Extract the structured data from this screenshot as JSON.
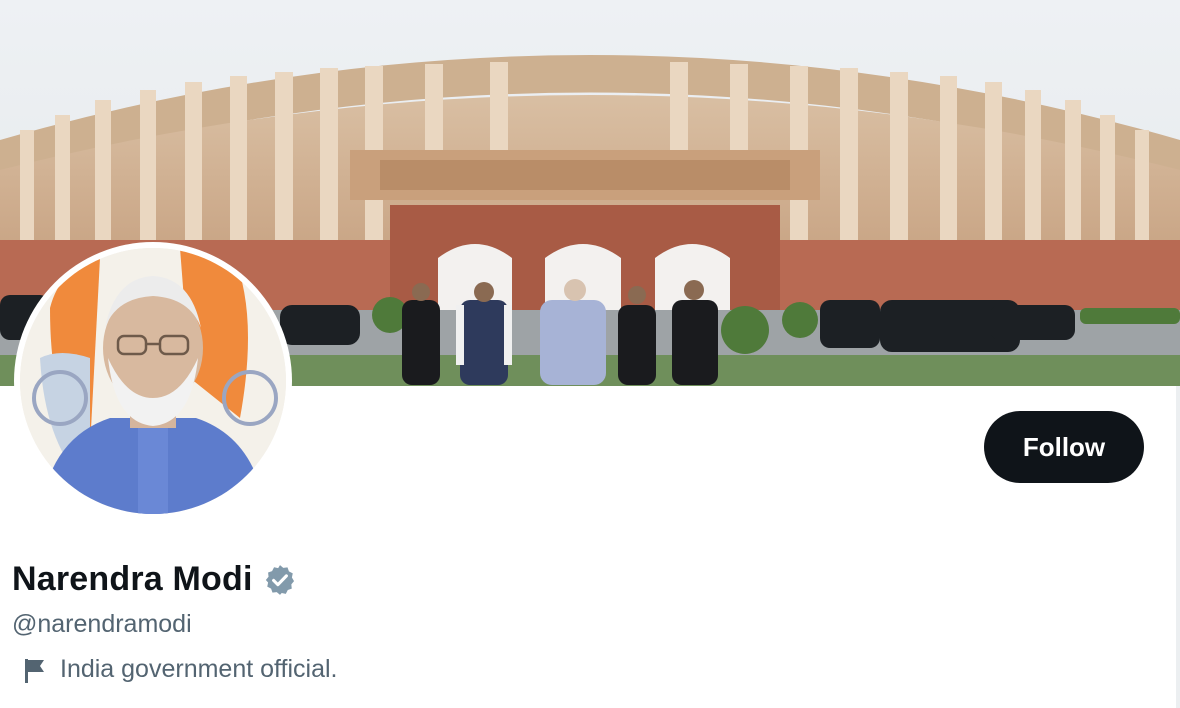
{
  "profile": {
    "display_name": "Narendra Modi",
    "handle": "@narendramodi",
    "category": "India government official.",
    "verified": true,
    "verified_badge_color": "#829aab"
  },
  "actions": {
    "follow_label": "Follow"
  },
  "icons": {
    "badge": "verified-badge-icon",
    "category": "flag-icon"
  },
  "colors": {
    "follow_button_bg": "#0f1419",
    "follow_button_text": "#ffffff",
    "secondary_text": "#536471"
  }
}
